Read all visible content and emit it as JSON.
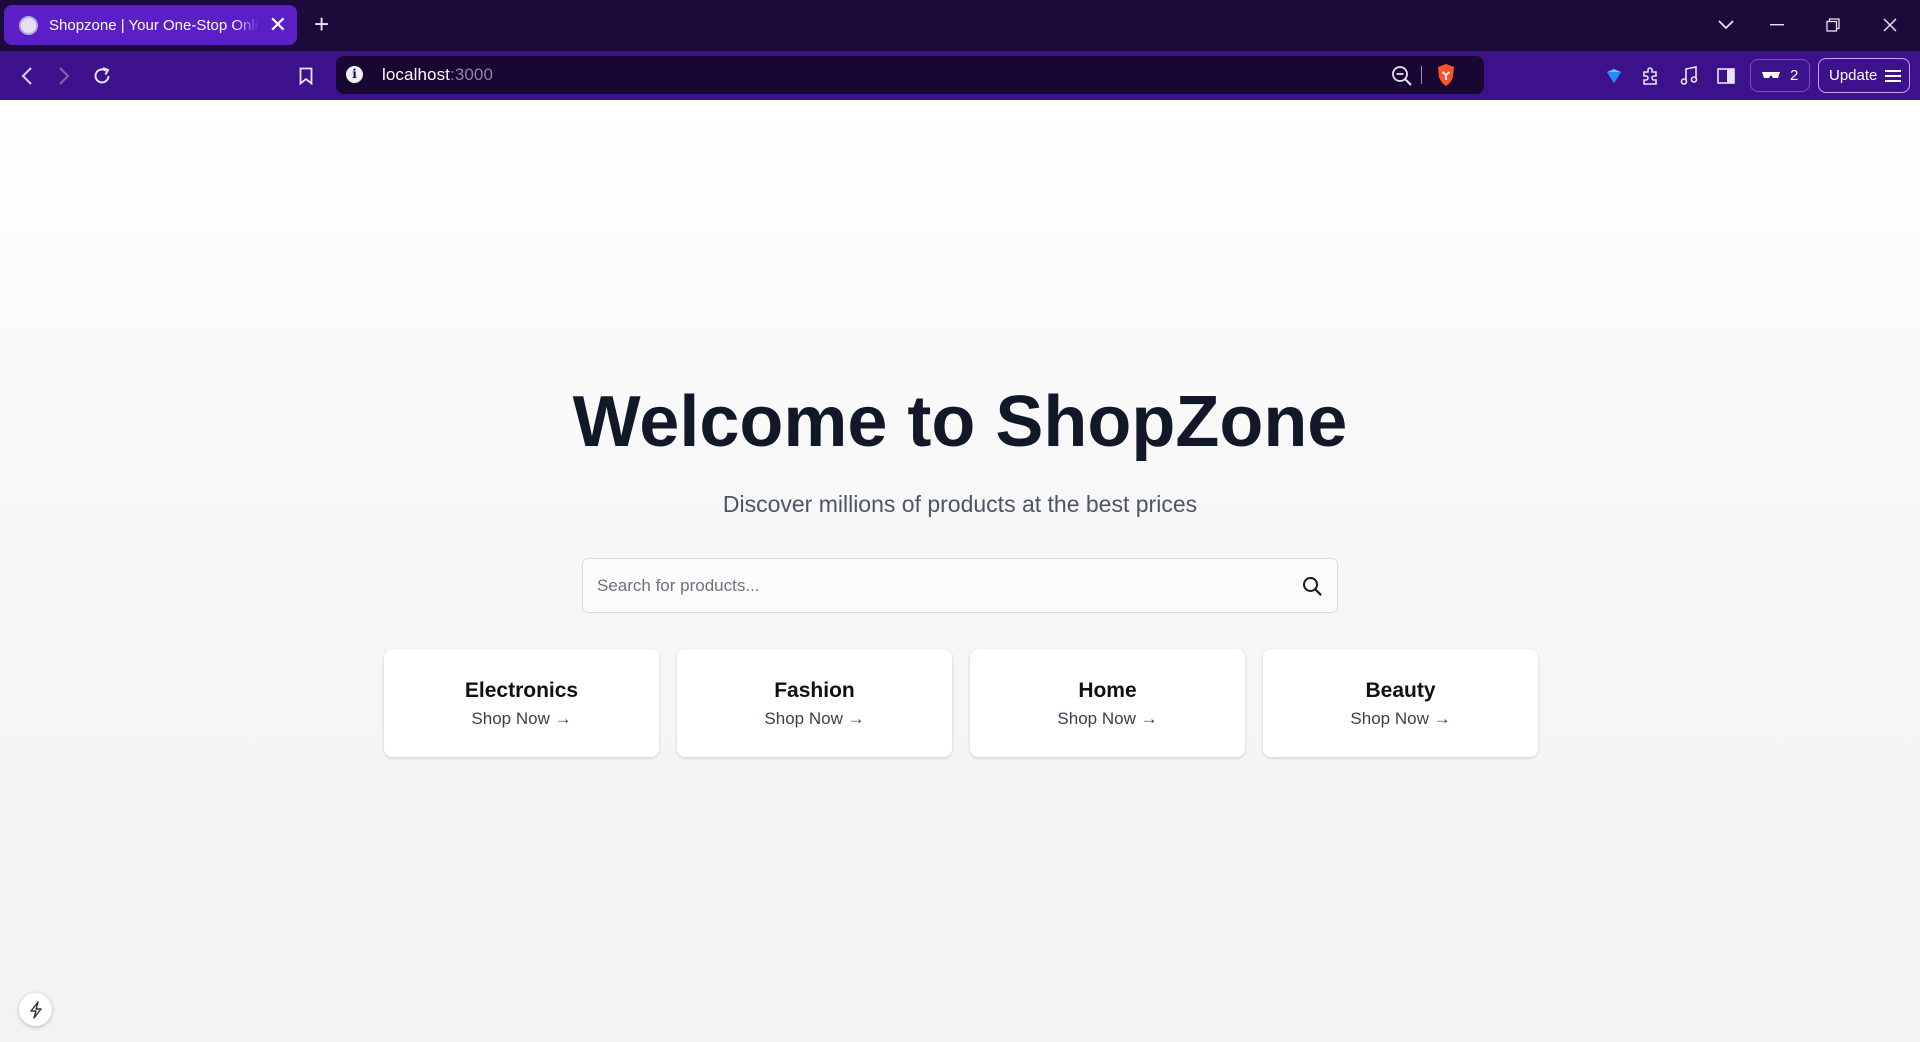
{
  "browser": {
    "tab_title": "Shopzone | Your One-Stop Online Store",
    "new_tab_symbol": "+",
    "close_symbol": "✕",
    "url_host": "localhost",
    "url_port": ":3000",
    "vpn_count": "2",
    "update_label": "Update",
    "accent_color": "#3d108c",
    "tabstrip_color": "#1b0a3a"
  },
  "hero": {
    "title": "Welcome to ShopZone",
    "subtitle": "Discover millions of products at the best prices"
  },
  "search": {
    "placeholder": "Search for products...",
    "value": ""
  },
  "categories": [
    {
      "name": "Electronics",
      "link": "Shop Now →"
    },
    {
      "name": "Fashion",
      "link": "Shop Now →"
    },
    {
      "name": "Home",
      "link": "Shop Now →"
    },
    {
      "name": "Beauty",
      "link": "Shop Now →"
    }
  ],
  "icons": [
    "tab-favicon-icon",
    "tab-close-icon",
    "new-tab-icon",
    "tab-list-icon",
    "minimize-icon",
    "restore-icon",
    "window-close-icon",
    "back-icon",
    "forward-icon",
    "reload-icon",
    "bookmark-icon",
    "site-info-icon",
    "zoom-out-icon",
    "brave-shield-icon",
    "wallet-icon",
    "extensions-icon",
    "media-icon",
    "sidebar-icon",
    "vpn-icon",
    "hamburger-menu-icon",
    "search-icon",
    "dev-tools-bolt-icon"
  ]
}
